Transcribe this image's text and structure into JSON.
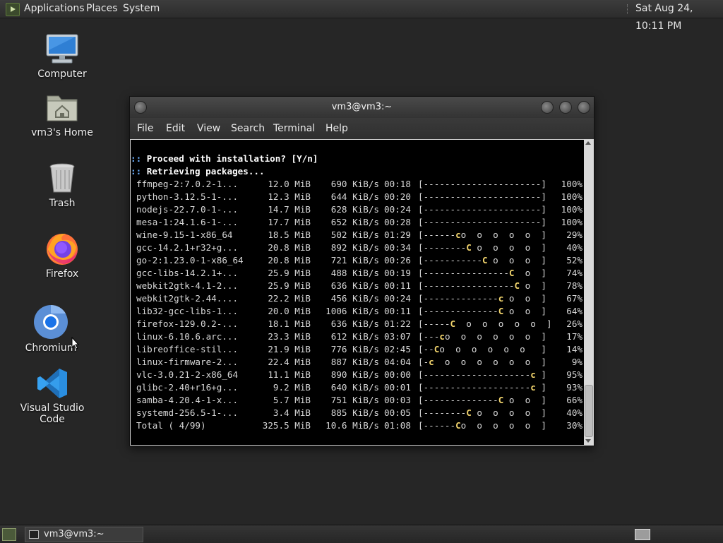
{
  "top_panel": {
    "menus": [
      "Applications",
      "Places",
      "System"
    ],
    "clock": "Sat Aug 24, 10:11 PM"
  },
  "desktop": {
    "icons": [
      {
        "label": "Computer",
        "icon": "computer-icon"
      },
      {
        "label": "vm3's Home",
        "icon": "home-folder-icon"
      },
      {
        "label": "Trash",
        "icon": "trash-icon"
      },
      {
        "label": "Firefox",
        "icon": "firefox-icon"
      },
      {
        "label": "Chromium",
        "icon": "chromium-icon"
      },
      {
        "label": "Visual Studio Code",
        "icon": "vscode-icon"
      }
    ]
  },
  "terminal": {
    "title": "vm3@vm3:~",
    "menu": [
      "File",
      "Edit",
      "View",
      "Search",
      "Terminal",
      "Help"
    ],
    "prompt_prefix": "::",
    "messages": [
      "Proceed with installation? [Y/n]",
      "Retrieving packages..."
    ],
    "packages": [
      {
        "name": "ffmpeg-2:7.0.2-1...",
        "size": "12.0 MiB",
        "speed": "690 KiB/s",
        "time": "00:18",
        "pre": "[----------------------",
        "pac": "",
        "post": "]",
        "pct": "100%"
      },
      {
        "name": "python-3.12.5-1-...",
        "size": "12.3 MiB",
        "speed": "644 KiB/s",
        "time": "00:20",
        "pre": "[----------------------",
        "pac": "",
        "post": "]",
        "pct": "100%"
      },
      {
        "name": "nodejs-22.7.0-1-...",
        "size": "14.7 MiB",
        "speed": "628 KiB/s",
        "time": "00:24",
        "pre": "[----------------------",
        "pac": "",
        "post": "]",
        "pct": "100%"
      },
      {
        "name": "mesa-1:24.1.6-1-...",
        "size": "17.7 MiB",
        "speed": "652 KiB/s",
        "time": "00:28",
        "pre": "[----------------------",
        "pac": "",
        "post": "]",
        "pct": "100%"
      },
      {
        "name": "wine-9.15-1-x86_64",
        "size": "18.5 MiB",
        "speed": "502 KiB/s",
        "time": "01:29",
        "pre": "[------",
        "pac": "c",
        "post": "o  o  o  o  o  ]",
        "pct": "29%"
      },
      {
        "name": "gcc-14.2.1+r32+g...",
        "size": "20.8 MiB",
        "speed": "892 KiB/s",
        "time": "00:34",
        "pre": "[--------",
        "pac": "C",
        "post": " o  o  o  o  ]",
        "pct": "40%"
      },
      {
        "name": "go-2:1.23.0-1-x86_64",
        "size": "20.8 MiB",
        "speed": "721 KiB/s",
        "time": "00:26",
        "pre": "[-----------",
        "pac": "C",
        "post": " o  o  o  ]",
        "pct": "52%"
      },
      {
        "name": "gcc-libs-14.2.1+...",
        "size": "25.9 MiB",
        "speed": "488 KiB/s",
        "time": "00:19",
        "pre": "[----------------",
        "pac": "C",
        "post": "  o  ]",
        "pct": "74%"
      },
      {
        "name": "webkit2gtk-4.1-2...",
        "size": "25.9 MiB",
        "speed": "636 KiB/s",
        "time": "00:11",
        "pre": "[-----------------",
        "pac": "C",
        "post": " o  ]",
        "pct": "78%"
      },
      {
        "name": "webkit2gtk-2.44....",
        "size": "22.2 MiB",
        "speed": "456 KiB/s",
        "time": "00:24",
        "pre": "[--------------",
        "pac": "c",
        "post": " o  o  ]",
        "pct": "67%"
      },
      {
        "name": "lib32-gcc-libs-1...",
        "size": "20.0 MiB",
        "speed": "1006 KiB/s",
        "time": "00:11",
        "pre": "[--------------",
        "pac": "C",
        "post": " o  o  ]",
        "pct": "64%"
      },
      {
        "name": "firefox-129.0.2-...",
        "size": "18.1 MiB",
        "speed": "636 KiB/s",
        "time": "01:22",
        "pre": "[-----",
        "pac": "C",
        "post": "  o  o  o  o  o  ]",
        "pct": "26%"
      },
      {
        "name": "linux-6.10.6.arc...",
        "size": "23.3 MiB",
        "speed": "612 KiB/s",
        "time": "03:07",
        "pre": "[---",
        "pac": "c",
        "post": "o  o  o  o  o  o  ]",
        "pct": "17%"
      },
      {
        "name": "libreoffice-stil...",
        "size": "21.9 MiB",
        "speed": "776 KiB/s",
        "time": "02:45",
        "pre": "[--",
        "pac": "C",
        "post": "o  o  o  o  o  o  ]",
        "pct": "14%"
      },
      {
        "name": "linux-firmware-2...",
        "size": "22.4 MiB",
        "speed": "887 KiB/s",
        "time": "04:04",
        "pre": "[-",
        "pac": "c",
        "post": "  o  o  o  o  o  o  ]",
        "pct": "9%"
      },
      {
        "name": "vlc-3.0.21-2-x86_64",
        "size": "11.1 MiB",
        "speed": "890 KiB/s",
        "time": "00:00",
        "pre": "[--------------------",
        "pac": "c",
        "post": " ]",
        "pct": "95%"
      },
      {
        "name": "glibc-2.40+r16+g...",
        "size": "9.2 MiB",
        "speed": "640 KiB/s",
        "time": "00:01",
        "pre": "[--------------------",
        "pac": "c",
        "post": " ]",
        "pct": "93%"
      },
      {
        "name": "samba-4.20.4-1-x...",
        "size": "5.7 MiB",
        "speed": "751 KiB/s",
        "time": "00:03",
        "pre": "[--------------",
        "pac": "C",
        "post": " o  o  ]",
        "pct": "66%"
      },
      {
        "name": "systemd-256.5-1-...",
        "size": "3.4 MiB",
        "speed": "885 KiB/s",
        "time": "00:05",
        "pre": "[--------",
        "pac": "C",
        "post": " o  o  o  o  ]",
        "pct": "40%"
      },
      {
        "name": "Total ( 4/99)",
        "size": "325.5 MiB",
        "speed": "10.6 MiB/s",
        "time": "01:08",
        "pre": "[------",
        "pac": "C",
        "post": "o  o  o  o  o  ]",
        "pct": "30%"
      }
    ]
  },
  "taskbar": {
    "window_button": "vm3@vm3:~"
  }
}
